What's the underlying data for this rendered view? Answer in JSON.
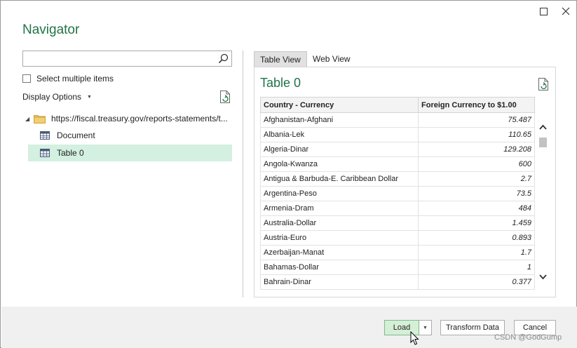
{
  "dialog": {
    "title": "Navigator",
    "minimize_glyph": "☐",
    "close_glyph": "✕"
  },
  "search": {
    "value": "",
    "placeholder": ""
  },
  "select_multiple": {
    "label": "Select multiple items",
    "checked": false
  },
  "display_options": {
    "label": "Display Options"
  },
  "tree": {
    "root": {
      "label": "https://fiscal.treasury.gov/reports-statements/t...",
      "expanded": true
    },
    "items": [
      {
        "label": "Document",
        "selected": false
      },
      {
        "label": "Table 0",
        "selected": true
      }
    ]
  },
  "tabs": [
    {
      "label": "Table View",
      "active": true
    },
    {
      "label": "Web View",
      "active": false
    }
  ],
  "preview": {
    "title": "Table 0",
    "columns": [
      "Country - Currency",
      "Foreign Currency to $1.00"
    ],
    "rows": [
      [
        "Afghanistan-Afghani",
        "75.487"
      ],
      [
        "Albania-Lek",
        "110.65"
      ],
      [
        "Algeria-Dinar",
        "129.208"
      ],
      [
        "Angola-Kwanza",
        "600"
      ],
      [
        "Antigua & Barbuda-E. Caribbean Dollar",
        "2.7"
      ],
      [
        "Argentina-Peso",
        "73.5"
      ],
      [
        "Armenia-Dram",
        "484"
      ],
      [
        "Australia-Dollar",
        "1.459"
      ],
      [
        "Austria-Euro",
        "0.893"
      ],
      [
        "Azerbaijan-Manat",
        "1.7"
      ],
      [
        "Bahamas-Dollar",
        "1"
      ],
      [
        "Bahrain-Dinar",
        "0.377"
      ]
    ]
  },
  "footer": {
    "load_label": "Load",
    "transform_label": "Transform Data",
    "cancel_label": "Cancel"
  },
  "watermark": "CSDN @GodGump",
  "colors": {
    "accent": "#217346",
    "selected_row": "#d3f0e0",
    "load_button": "#d5efd7",
    "footer_bg": "#f0f0f0"
  }
}
